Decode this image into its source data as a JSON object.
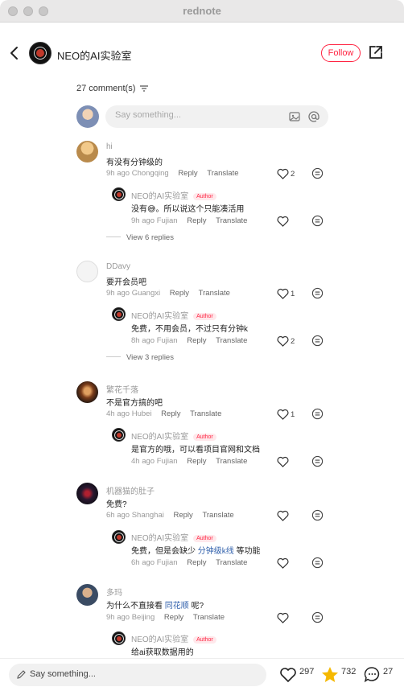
{
  "window": {
    "title": "rednote"
  },
  "header": {
    "channel_name": "NEO的AI实验室",
    "follow_label": "Follow"
  },
  "comments_header": {
    "count_label": "27 comment(s)"
  },
  "input": {
    "placeholder": "Say something..."
  },
  "comments": [
    {
      "user": "hi",
      "text": "有没有分钟级的",
      "time": "9h ago",
      "location": "Chongqing",
      "reply_label": "Reply",
      "translate_label": "Translate",
      "likes": "2",
      "reply": {
        "user": "NEO的AI实验室",
        "badge": "Author",
        "text_a": "没有",
        "emoji": "😅",
        "text_b": "。所以说这个只能凑活用",
        "time": "9h ago",
        "location": "Fujian",
        "reply_label": "Reply",
        "translate_label": "Translate"
      },
      "view_replies": "View 6 replies"
    },
    {
      "user": "DDavy",
      "text": "要开会员吧",
      "time": "9h ago",
      "location": "Guangxi",
      "reply_label": "Reply",
      "translate_label": "Translate",
      "likes": "1",
      "reply": {
        "user": "NEO的AI实验室",
        "badge": "Author",
        "text": "免费，不用会员，不过只有分钟k",
        "time": "8h ago",
        "location": "Fujian",
        "reply_label": "Reply",
        "translate_label": "Translate",
        "likes": "2"
      },
      "view_replies": "View 3 replies"
    },
    {
      "user": "繁花千落",
      "text": "不是官方搞的吧",
      "time": "4h ago",
      "location": "Hubei",
      "reply_label": "Reply",
      "translate_label": "Translate",
      "likes": "1",
      "reply": {
        "user": "NEO的AI实验室",
        "badge": "Author",
        "text": "是官方的哦，可以看项目官网和文档",
        "time": "4h ago",
        "location": "Fujian",
        "reply_label": "Reply",
        "translate_label": "Translate"
      }
    },
    {
      "user": "机器猫的肚子",
      "text": "免费?",
      "time": "6h ago",
      "location": "Shanghai",
      "reply_label": "Reply",
      "translate_label": "Translate",
      "reply": {
        "user": "NEO的AI实验室",
        "badge": "Author",
        "text_a": "免费，但是会缺少 ",
        "link": "分钟级k线",
        "text_b": " 等功能",
        "time": "6h ago",
        "location": "Fujian",
        "reply_label": "Reply",
        "translate_label": "Translate"
      }
    },
    {
      "user": "多玛",
      "text_a": "为什么不直接看 ",
      "link": "同花顺",
      "text_b": " 呢?",
      "time": "9h ago",
      "location": "Beijing",
      "reply_label": "Reply",
      "translate_label": "Translate",
      "reply": {
        "user": "NEO的AI实验室",
        "badge": "Author",
        "text": "给ai获取数据用的"
      }
    }
  ],
  "bottom_bar": {
    "placeholder": "Say something...",
    "likes": "297",
    "stars": "732",
    "comments": "27"
  },
  "colors": {
    "accent": "#ff2442",
    "link": "#2f5fab",
    "star": "#f5b800"
  }
}
